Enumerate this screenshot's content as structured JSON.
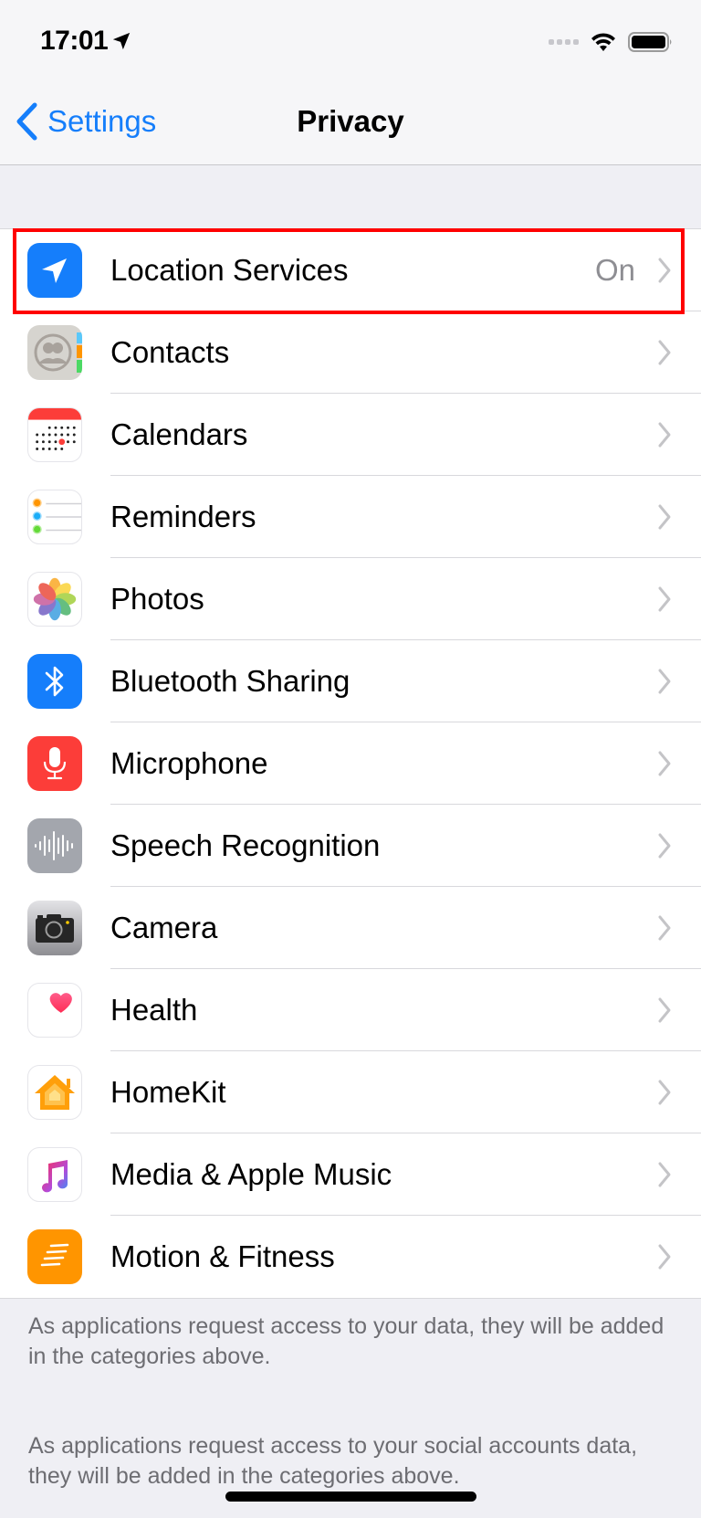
{
  "status_bar": {
    "time": "17:01",
    "location_active_icon": "location-arrow-icon",
    "signal_icon": "cellular-signal-icon",
    "wifi_icon": "wifi-icon",
    "battery_icon": "battery-icon"
  },
  "nav": {
    "back_label": "Settings",
    "back_icon": "chevron-left-icon",
    "title": "Privacy"
  },
  "items": [
    {
      "label": "Location Services",
      "value": "On",
      "icon": "location-icon",
      "icon_bg": "#157efb",
      "highlighted": true
    },
    {
      "label": "Contacts",
      "value": "",
      "icon": "contacts-icon",
      "icon_bg": "#d6d4cf"
    },
    {
      "label": "Calendars",
      "value": "",
      "icon": "calendar-icon",
      "icon_bg": "#ffffff"
    },
    {
      "label": "Reminders",
      "value": "",
      "icon": "reminders-icon",
      "icon_bg": "#ffffff"
    },
    {
      "label": "Photos",
      "value": "",
      "icon": "photos-icon",
      "icon_bg": "#ffffff"
    },
    {
      "label": "Bluetooth Sharing",
      "value": "",
      "icon": "bluetooth-icon",
      "icon_bg": "#157efb"
    },
    {
      "label": "Microphone",
      "value": "",
      "icon": "microphone-icon",
      "icon_bg": "#fc3d39"
    },
    {
      "label": "Speech Recognition",
      "value": "",
      "icon": "speech-recognition-icon",
      "icon_bg": "#a3a6ad"
    },
    {
      "label": "Camera",
      "value": "",
      "icon": "camera-icon",
      "icon_bg": "#8e8e93"
    },
    {
      "label": "Health",
      "value": "",
      "icon": "health-icon",
      "icon_bg": "#ffffff"
    },
    {
      "label": "HomeKit",
      "value": "",
      "icon": "homekit-icon",
      "icon_bg": "#ffffff"
    },
    {
      "label": "Media & Apple Music",
      "value": "",
      "icon": "music-icon",
      "icon_bg": "#ffffff"
    },
    {
      "label": "Motion & Fitness",
      "value": "",
      "icon": "motion-fitness-icon",
      "icon_bg": "#ff9500"
    }
  ],
  "footer": {
    "note_1": "As applications request access to your data, they will be added in the categories above.",
    "note_2": "As applications request access to your social accounts data, they will be added in the categories above."
  },
  "colors": {
    "accent": "#157efb",
    "highlight_box": "#ff0000",
    "secondary_text": "#8e8e93",
    "background": "#efeff4"
  }
}
